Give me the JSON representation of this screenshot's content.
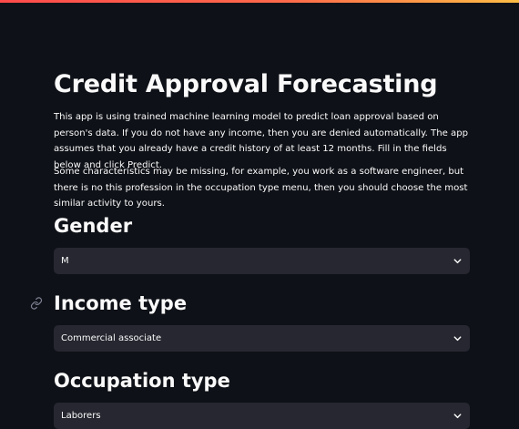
{
  "page": {
    "title": "Credit Approval Forecasting",
    "intro": "This app is using trained machine learning model to predict loan approval based on person's data. If you do not have any income, then you are denied automatically. The app assumes that you already have a credit history of at least 12 months. Fill in the fields below and click Predict.",
    "note": "Some characteristics may be missing, for example, you work as a software engineer, but there is no this profession in the occupation type menu, then you should choose the most similar activity to yours."
  },
  "gender": {
    "heading": "Gender",
    "selected": "M"
  },
  "income_type": {
    "heading": "Income type",
    "selected": "Commercial associate"
  },
  "occupation_type": {
    "heading": "Occupation type",
    "selected": "Laborers"
  },
  "icons": {
    "dropdown": "chevron-down-icon",
    "anchor": "link-icon"
  },
  "colors": {
    "background": "#0e1117",
    "select_bg": "#262730",
    "text": "#fafafa",
    "accent_start": "#ff4b4b",
    "accent_end": "#ffbd45"
  }
}
